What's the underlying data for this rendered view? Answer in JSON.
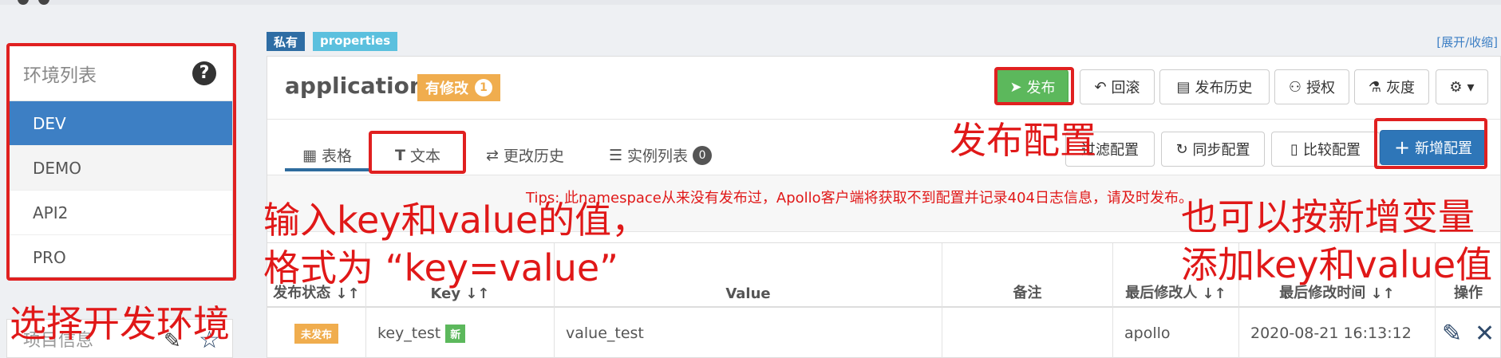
{
  "sidebar": {
    "env_title": "环境列表",
    "help_symbol": "?",
    "envs": [
      "DEV",
      "DEMO",
      "API2",
      "PRO"
    ],
    "project_title": "项目信息"
  },
  "namespace": {
    "tag_private": "私有",
    "tag_format": "properties",
    "expand_link": "[展开/收缩]",
    "name": "application",
    "modified_label": "有修改",
    "modified_count": "1"
  },
  "toolbar": {
    "publish": "发布",
    "rollback": "回滚",
    "history": "发布历史",
    "authorize": "授权",
    "gray": "灰度"
  },
  "tabs": {
    "table": "表格",
    "text": "文本",
    "change_history": "更改历史",
    "instances": "实例列表",
    "instances_count": "0"
  },
  "actions": {
    "filter": "过滤配置",
    "sync": "同步配置",
    "compare": "比较配置",
    "add": "新增配置"
  },
  "tips": "Tips: 此namespace从来没有发布过，Apollo客户端将获取不到配置并记录404日志信息，请及时发布。",
  "table": {
    "headers": {
      "status": "发布状态",
      "key": "Key",
      "value": "Value",
      "comment": "备注",
      "modifier": "最后修改人",
      "modified_time": "最后修改时间",
      "ops": "操作"
    },
    "rows": [
      {
        "status": "未发布",
        "key": "key_test",
        "new_tag": "新",
        "value": "value_test",
        "comment": "",
        "modifier": "apollo",
        "time": "2020-08-21 16:13:12"
      }
    ]
  },
  "annotations": {
    "publish_config": "发布配置",
    "input_kv_line1": "输入key和value的值，",
    "input_kv_line2": "格式为 “key=value”",
    "add_var_line1": "也可以按新增变量",
    "add_var_line2": "添加key和value值",
    "select_env": "选择开发环境"
  },
  "colors": {
    "accent": "#3d7fc4",
    "publish_green": "#5cb85c",
    "warning_orange": "#f0ad4e",
    "annotation_red": "#e01818"
  }
}
